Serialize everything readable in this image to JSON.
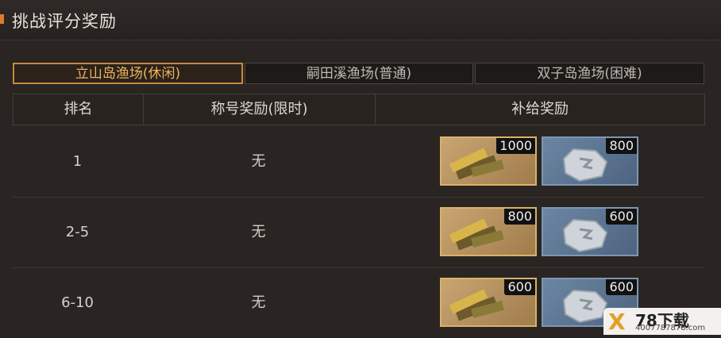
{
  "header": {
    "title": "挑战评分奖励",
    "accent_color": "#e07a2a"
  },
  "tabs": [
    {
      "label": "立山岛渔场(休闲)",
      "active": true
    },
    {
      "label": "嗣田溪渔场(普通)",
      "active": false
    },
    {
      "label": "双子岛渔场(困难)",
      "active": false
    }
  ],
  "table": {
    "headers": [
      "排名",
      "称号奖励(限时)",
      "补给奖励"
    ],
    "rows": [
      {
        "rank": "1",
        "title_reward": "无",
        "rewards": [
          {
            "icon": "gold-bars-icon",
            "amount": "1000"
          },
          {
            "icon": "silver-ore-icon",
            "amount": "800"
          }
        ]
      },
      {
        "rank": "2-5",
        "title_reward": "无",
        "rewards": [
          {
            "icon": "gold-bars-icon",
            "amount": "800"
          },
          {
            "icon": "silver-ore-icon",
            "amount": "600"
          }
        ]
      },
      {
        "rank": "6-10",
        "title_reward": "无",
        "rewards": [
          {
            "icon": "gold-bars-icon",
            "amount": "600"
          },
          {
            "icon": "silver-ore-icon",
            "amount": "600"
          }
        ]
      }
    ]
  },
  "watermark": {
    "brand": "78下载",
    "url": "4007787878.com"
  }
}
